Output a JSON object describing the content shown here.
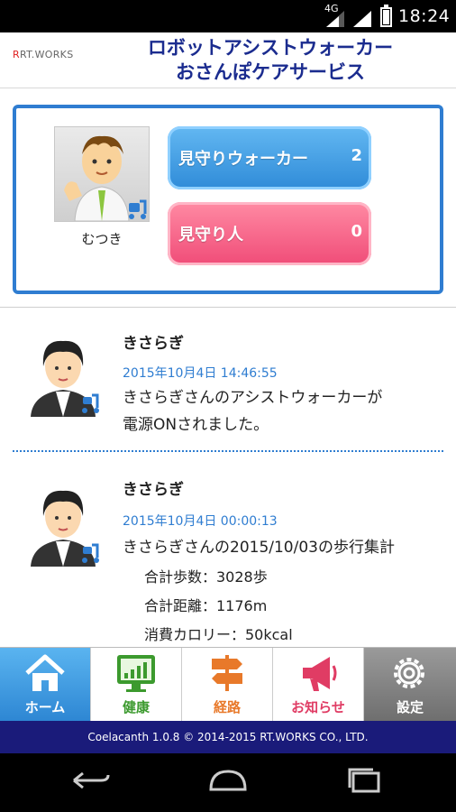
{
  "status_bar": {
    "network": "4G",
    "time": "18:24"
  },
  "header": {
    "logo": "RT.WORKS",
    "title_line1": "ロボットアシストウォーカー",
    "title_line2": "おさんぽケアサービス"
  },
  "summary": {
    "profile_name": "むつき",
    "walker_label": "見守りウォーカー",
    "walker_count": "2",
    "watcher_label": "見守り人",
    "watcher_count": "0"
  },
  "feed": [
    {
      "user": "きさらぎ",
      "time": "2015年10月4日 14:46:55",
      "message_line1": "きさらぎさんのアシストウォーカーが",
      "message_line2": "電源ONされました。"
    },
    {
      "user": "きさらぎ",
      "time": "2015年10月4日 00:00:13",
      "message_line1": "きさらぎさんの2015/10/03の歩行集計",
      "steps": "合計歩数：3028歩",
      "distance": "合計距離：1176m",
      "calories": "消費カロリー：50kcal"
    }
  ],
  "tabs": {
    "home": "ホーム",
    "health": "健康",
    "route": "経路",
    "notice": "お知らせ",
    "settings": "設定"
  },
  "footer": "Coelacanth 1.0.8 © 2014-2015 RT.WORKS CO., LTD.",
  "colors": {
    "title": "#1b2c8f",
    "accent_blue": "#2f7dd1",
    "pink": "#f04c78",
    "footer_bg": "#1a1b7a"
  }
}
